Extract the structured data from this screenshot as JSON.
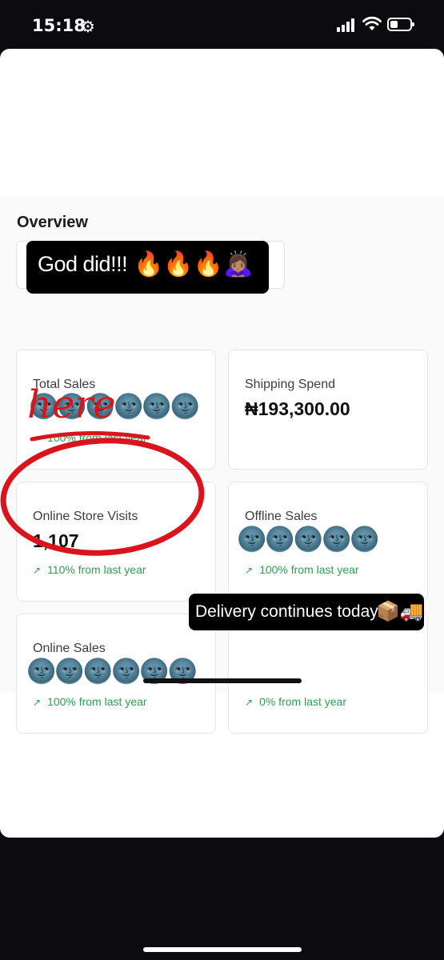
{
  "status_bar": {
    "time": "15:18",
    "settings_glyph": "⚙"
  },
  "dashboard": {
    "section_title": "Overview",
    "cards": [
      {
        "label": "Total Sales",
        "value": "",
        "delta": "100% from last year",
        "hidden_value_emoji": "🌚🌚🌚🌚🌚🌚"
      },
      {
        "label": "Shipping Spend",
        "value": "₦193,300.00",
        "delta": ""
      },
      {
        "label": "Online Store Visits",
        "value": "1,107",
        "delta": "110% from last year"
      },
      {
        "label": "Offline Sales",
        "value": "",
        "delta": "100% from last year",
        "hidden_value_emoji": "🌚🌚🌚🌚🌚"
      },
      {
        "label": "Online Sales",
        "value": "",
        "delta": "100% from last year",
        "hidden_value_emoji": "🌚🌚🌚🌚🌚🌚"
      },
      {
        "label": "",
        "value": "",
        "delta": "0% from last year"
      }
    ],
    "delta_arrow": "↗"
  },
  "stickers": {
    "god_did_text": "God did!!!",
    "god_did_emoji": "🔥🔥🔥🙇🏽‍♀️",
    "delivery_text": "Delivery continues today",
    "delivery_emoji": "📦🚚",
    "handwritten": "here"
  },
  "colors": {
    "positive": "#2e9e4f",
    "annotation": "#d9141c",
    "background": "#0b0b10"
  }
}
